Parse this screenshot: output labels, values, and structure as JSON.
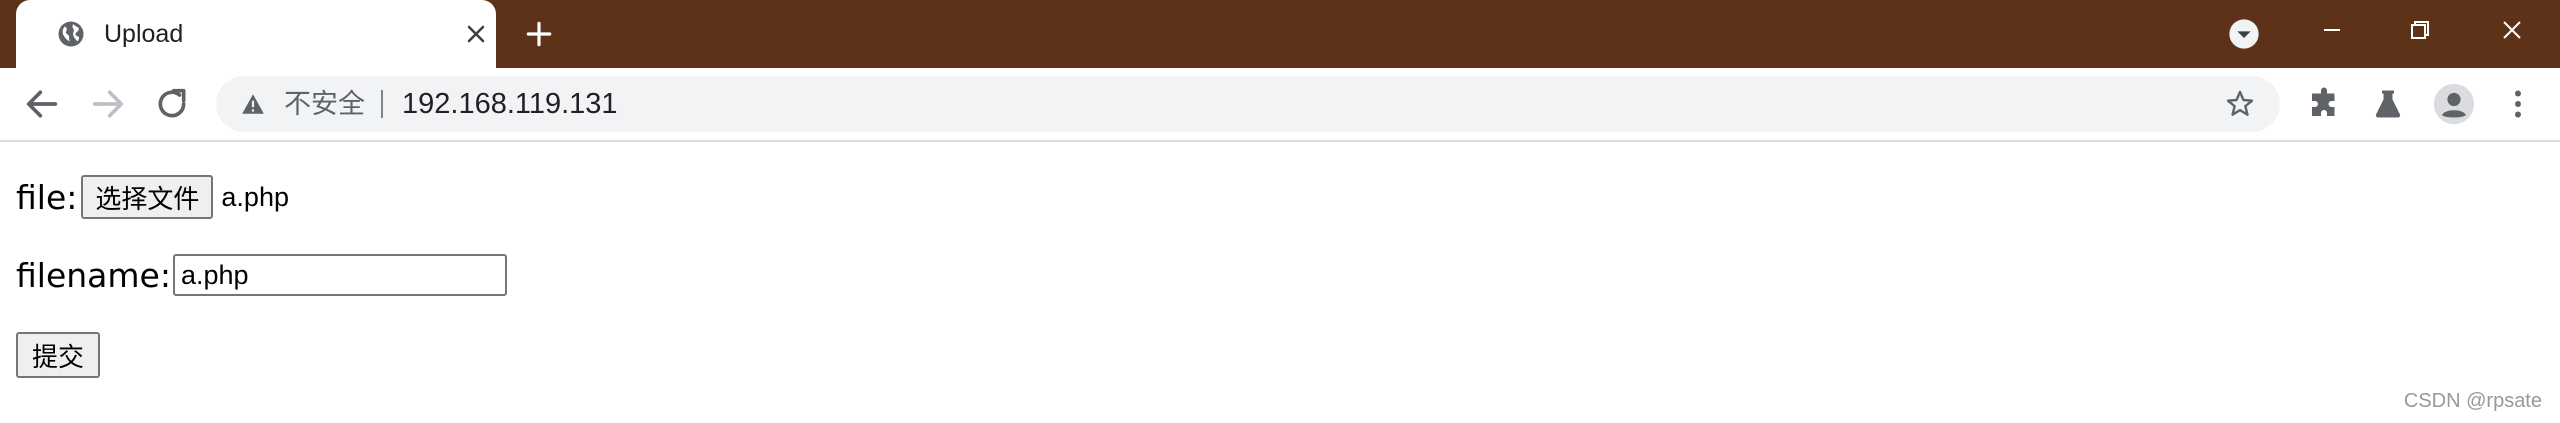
{
  "browser": {
    "tab": {
      "title": "Upload",
      "favicon": "globe-icon"
    },
    "address_bar": {
      "security_label": "不安全",
      "url": "192.168.119.131"
    },
    "colors": {
      "tab_strip": "#5e3218",
      "omnibox": "#f1f3f4"
    }
  },
  "form": {
    "file_label": "file:",
    "choose_file_button": "选择文件",
    "chosen_file": "a.php",
    "filename_label": "filename:",
    "filename_value": "a.php",
    "submit_button": "提交"
  },
  "watermark": "CSDN @rpsate"
}
